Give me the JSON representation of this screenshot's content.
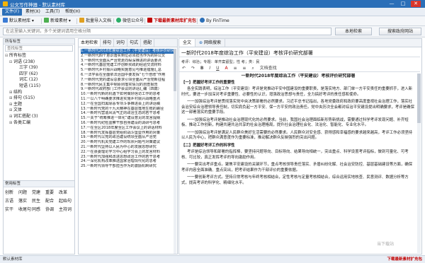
{
  "titlebar": {
    "title": "公文写作神器 - 默认素材库",
    "minimize": "—",
    "maximize": "□",
    "close": "✕"
  },
  "menu": [
    {
      "label": "文件(F)",
      "active": true
    },
    {
      "label": "素材(X)"
    },
    {
      "label": "工具(T)"
    },
    {
      "label": "帮助(H)"
    }
  ],
  "toolbar": {
    "default_lib": "默认素材库 ▾",
    "new_material": "新增素材 ▾",
    "batch_import": "批量导入文档",
    "wechat": "微信公众号",
    "download": "下载最新素材库扩充包",
    "byfintime": "By FinTime",
    "colors": {
      "accent": "#2b6fb8",
      "red": "#c00000"
    }
  },
  "search": {
    "placeholder": "在这里输入关键词，多个关键词请用空格分隔",
    "local": "本地检索",
    "online": "搜索政府网站"
  },
  "left": {
    "header": "所有标签",
    "search_placeholder": "查找标签",
    "tree": [
      {
        "tog": "⊟",
        "label": "所有标签",
        "level": 0
      },
      {
        "tog": "⊟",
        "label": "词语 (238)",
        "level": 1
      },
      {
        "tog": "",
        "label": "三字 (39)",
        "level": 2
      },
      {
        "tog": "",
        "label": "四字 (62)",
        "level": 2
      },
      {
        "tog": "",
        "label": "词汇 (12)",
        "level": 2
      },
      {
        "tog": "",
        "label": "短语 (115)",
        "level": 2
      },
      {
        "tog": "⊞",
        "label": "结构",
        "level": 1
      },
      {
        "tog": "⊞",
        "label": "排句 (515)",
        "level": 1
      },
      {
        "tog": "⊞",
        "label": "主题",
        "level": 1
      },
      {
        "tog": "⊞",
        "label": "文体",
        "level": 1
      },
      {
        "tog": "⊞",
        "label": "词汇搭配 (3)",
        "level": 1
      },
      {
        "tog": "⊞",
        "label": "各类汇编",
        "level": 1
      }
    ],
    "freq_header": "常用标签",
    "freq_tags": [
      "创新",
      "问题",
      "党建",
      "重要",
      "改革",
      "古语",
      "落实",
      "民生",
      "配合",
      "起始句",
      "实干",
      "收尾句",
      "同感",
      "协调",
      "主持词"
    ]
  },
  "middle": {
    "tabs": [
      "本地检索",
      "排句",
      "词句",
      "句式",
      "搭配"
    ],
    "lines": [
      "1.一新时代2018年度综治工作（平安建设）考核评价研究",
      "2.一新时代四个意识落实到位必须担当作为的好公文",
      "3.一新时代全面从严治党走向纵深推进的讲话要点",
      "4.一新时代基层党建工作创新实践的经验交流材料",
      "5.一新时代乡村振兴战略实施意见与推进措施汇总",
      "6.一法学会在全面依法治国中要发挥“七个倍增”作用",
      "7.一新时代党的建设总要求引领全面从严治党新征程",
      "8.一新时代民主集中制原则落实情况的自查报告",
      "9.一新时代政府部门工作会议的讲话汇编（四篇）",
      "10.一新时代新的机遇下如何做好信访工作的思考",
      "11.一以八个明确要求推进实施乡村振兴战略重点",
      "12.一在全国扫黑除恶专项斗争推进会上的讲话稿",
      "13.一新时代党的十九大精神在基层落地生根的路径",
      "14.一新时代营造风清气正的政治生态的若干思考",
      "15.一关于“统筹推进一体化”建设意见的发言提纲",
      "16.一新时代纪检监察干部自身建设的调研与思考",
      "17.一在全区2018年度全区工作会议上的讲话材料",
      "18.一新时代发挥基层党组织战斗堡垒作用的对策",
      "19.一新时代以党的政治建设统领全面从严治党",
      "20.一新时代机关党建工作的现状问题与对策建议",
      "21.一新时代坚持以人民为中心的发展思想研究",
      "22.一在县委理论学习中心组学习会上的发言材料",
      "23.一新时代加强和改进思想政治工作的若干思考",
      "24.一深化机构改革推进国家治理现代化的思考",
      "25.一新时代领导干部担当作为的激励机制研究"
    ]
  },
  "right": {
    "tabs": [
      "全文",
      "网络搜索"
    ],
    "title": "一新时代2018年度综治工作（平安建设）考核评价研究部署",
    "meta": "考评：综治；专题：单齐案留型；性 考；类：民",
    "edit_tools": [
      "↶",
      "↷",
      "B",
      "I",
      "U",
      "A",
      "≡",
      "≡",
      "文档查找"
    ],
    "content_title": "一新时代2018年度综治工作（平安建设）考核评价研究部署",
    "blocks": [
      {
        "kind": "h",
        "text": "【一】把握好考评工作的重要性"
      },
      {
        "kind": "p",
        "text": "各全实践表明，综治工作（平安建设）考评是党推动平安中国建设的重要职责，是落实地方、部门单一方平安责任的重要抓手，进入新时代，要进一步加深对考评重要性、必要性的认识，增强政治思想与责任，全力搞好考评的责任感和使命。"
      },
      {
        "kind": "p",
        "text": "一一加强综治考评是贯彻落实党中央决策部署的必然要求。习近平总书记指出，各地党委政府和政府要高度重视社会治理工作，落实社会治安综合治理领导责任制，切实肩负起一方平安、保一方平安的政治责任。党中央历次全会都对综治平安建设提出明确要求，考评是确保这一部署落实的重要手段。"
      },
      {
        "kind": "p",
        "text": "一一加强综治考评是推动社会治理现代化的必然要求。当前，我国社会治理面临新形势新挑战，需要通过科学考评发现问题、补齐短板、推动工作创新，构建共建共治共享的社会治理格局，提升社会治理社会化、法治化、智能化、专业化水平。"
      },
      {
        "kind": "p",
        "text": "一一加强综治考评是满足人民群众美好生活需要的必然要求。人民群众对安全感、获得感和幸福感的要求越来越高，考评工作必须坚持以人民为中心，把群众满意度作为重要标准，推动解决群众反映强烈的突出问题。"
      },
      {
        "kind": "h",
        "text": "【二】把握好考评工作的科学性"
      },
      {
        "kind": "p",
        "text": "考评是综治领导和部署的指挥棒，要坚持问题导向、目标导向、结果导向相统一，突出重点、科学设置考评指标，做到可量化、可考核、可比较，真正发挥考评的导向激励作用。"
      },
      {
        "kind": "p",
        "text": "一一要突出考评重点。聚焦平安建设的关键环节，重点考核领导责任落实、矛盾纠纷化解、社会治安防控、基层基础建设等方面，确保考评内容全面准确、重点突出，把考评结果作为干部评价的重要依据。"
      },
      {
        "kind": "p",
        "text": "一一要创新考评方式。坚持日常考核与年终考核相结合，定性考核与定量考核相结合，综合运用实地核查、民意测评、数据分析等方式，提高考评的科学化、精细化水平。"
      }
    ]
  },
  "status": {
    "left": "默认素材库",
    "right": "下载最新素材扩充包"
  },
  "watermark": "当下载站"
}
